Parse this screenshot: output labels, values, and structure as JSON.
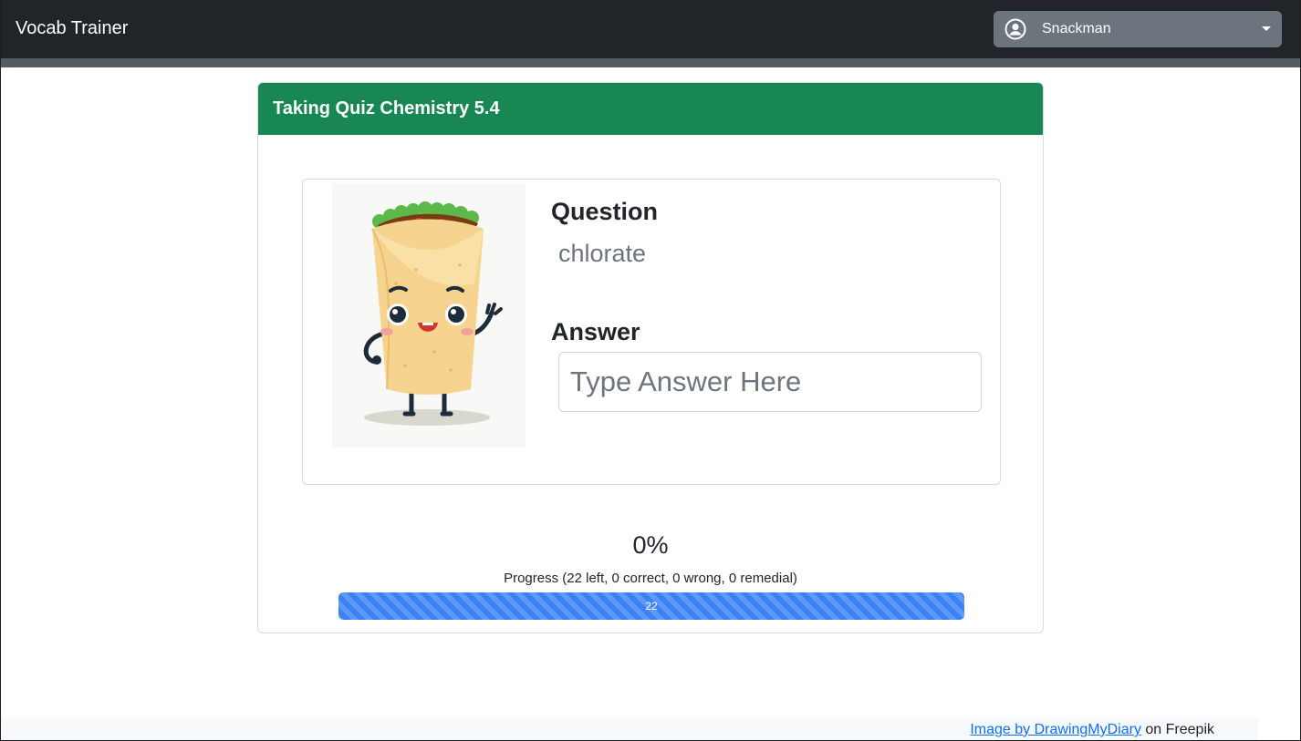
{
  "navbar": {
    "brand": "Vocab Trainer",
    "user": {
      "name": "Snackman",
      "icon": "user-circle-icon",
      "menu_icon": "caret-down-icon"
    }
  },
  "quiz": {
    "title": "Taking Quiz Chemistry 5.4",
    "illustration": "burrito-mascot-illustration",
    "question_label": "Question",
    "question": "chlorate",
    "answer_label": "Answer",
    "answer_placeholder": "Type Answer Here",
    "answer_value": ""
  },
  "progress": {
    "percent_text": "0%",
    "summary": "Progress (22 left, 0 correct, 0 wrong, 0 remedial)",
    "bar_label": "22",
    "remaining_fraction": 1.0
  },
  "footer": {
    "link_text": "Image by DrawingMyDiary",
    "suffix": " on Freepik"
  },
  "colors": {
    "navbar": "#212529",
    "header": "#198754",
    "progress_bar": "#3b82f6",
    "user_menu": "#6c757d"
  }
}
